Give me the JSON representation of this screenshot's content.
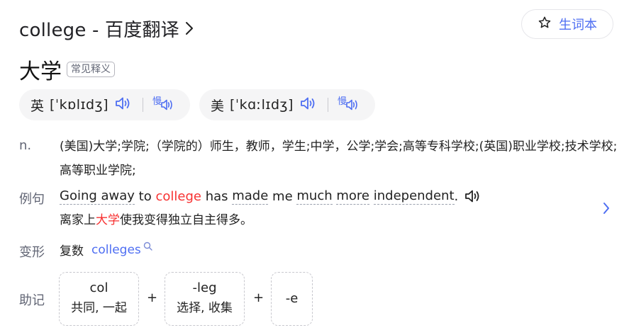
{
  "header": {
    "title": "college - 百度翻译",
    "vocab_button_label": "生词本"
  },
  "headword": {
    "word": "大学",
    "badge": "常见释义"
  },
  "pronunciations": [
    {
      "lang": "英",
      "ipa": "[ˈkɒlɪdʒ]"
    },
    {
      "lang": "美",
      "ipa": "[ˈkɑːlɪdʒ]"
    }
  ],
  "definition": {
    "pos": "n.",
    "text": "(美国)大学;学院;（学院的）师生，教师，学生;中学，公学;学会;高等专科学校;(英国)职业学校;技术学校;高等职业学院;"
  },
  "example": {
    "label": "例句",
    "en_parts": [
      "Going away",
      " to ",
      "college",
      " has ",
      "made",
      " me ",
      "much",
      " ",
      "more",
      " ",
      "independent",
      "."
    ],
    "zh_before": "离家上",
    "zh_highlight": "大学",
    "zh_after": "使我变得独立自主得多。"
  },
  "inflection": {
    "label": "变形",
    "kind": "复数",
    "word": "colleges"
  },
  "mnemonic": {
    "label": "助记",
    "parts": [
      {
        "part": "col",
        "meaning": "共同, 一起"
      },
      {
        "part": "-leg",
        "meaning": "选择, 收集"
      },
      {
        "part": "-e",
        "meaning": ""
      }
    ],
    "plus": "+"
  },
  "icons": {
    "title_chevron": "chevron-right-icon",
    "vocab": "star-outline-icon",
    "speaker": "speaker-icon",
    "slow_speaker": "slow-speaker-icon",
    "example_next": "chevron-right-icon",
    "search": "magnifier-icon"
  },
  "colors": {
    "accent": "#4e6ef2",
    "highlight": "#f73131",
    "muted": "#626675",
    "pill_bg": "#f5f5f6"
  }
}
